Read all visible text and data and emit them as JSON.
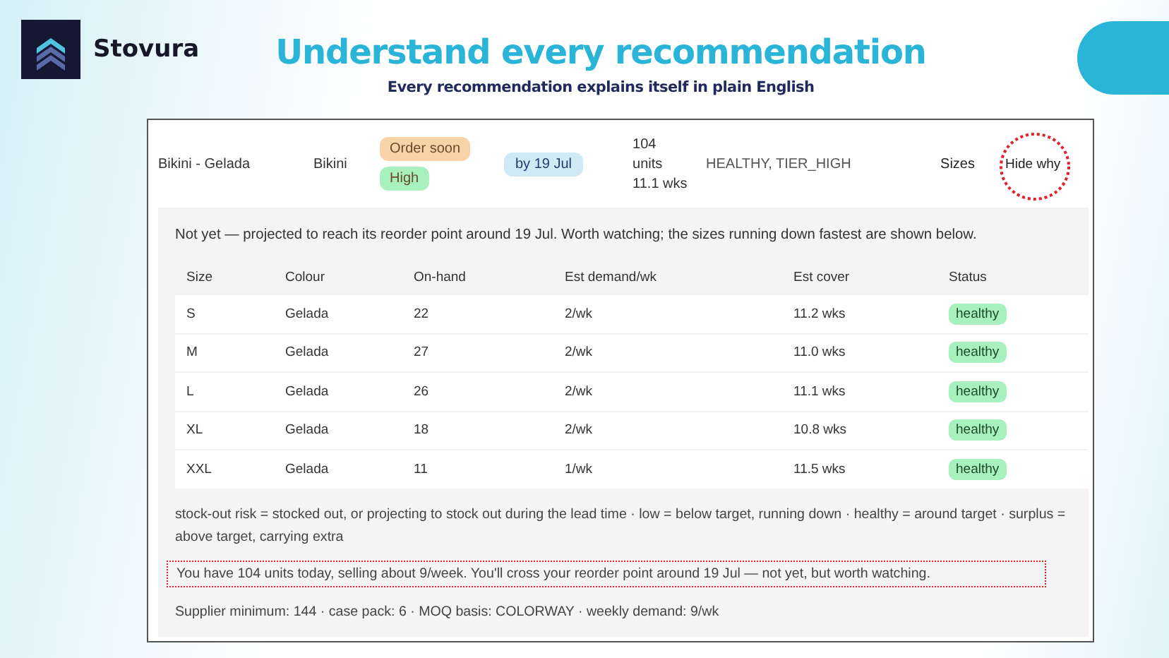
{
  "brand": {
    "name": "Stovura"
  },
  "headline": "Understand every recommendation",
  "subheadline": "Every recommendation explains itself in plain English",
  "item_row": {
    "name": "Bikini - Gelada",
    "category": "Bikini",
    "badges": [
      {
        "label": "Order soon",
        "color": "#f8d3a8"
      },
      {
        "label": "High",
        "color": "#a8f0bd"
      }
    ],
    "date_badge": "by 19 Jul",
    "units": [
      "104",
      "units",
      "11.1 wks"
    ],
    "flags": "HEALTHY, TIER_HIGH",
    "sizes_link": "Sizes",
    "hide_why": "Hide why"
  },
  "explanation": {
    "summary": "Not yet — projected to reach its reorder point around 19 Jul. Worth watching; the sizes running down fastest are shown below.",
    "table": {
      "columns": [
        "Size",
        "Colour",
        "On-hand",
        "Est demand/wk",
        "Est cover",
        "Status"
      ],
      "rows": [
        [
          "S",
          "Gelada",
          "22",
          "2/wk",
          "11.2 wks",
          "healthy"
        ],
        [
          "M",
          "Gelada",
          "27",
          "2/wk",
          "11.0 wks",
          "healthy"
        ],
        [
          "L",
          "Gelada",
          "26",
          "2/wk",
          "11.1 wks",
          "healthy"
        ],
        [
          "XL",
          "Gelada",
          "18",
          "2/wk",
          "10.8 wks",
          "healthy"
        ],
        [
          "XXL",
          "Gelada",
          "11",
          "1/wk",
          "11.5 wks",
          "healthy"
        ]
      ]
    },
    "legend": "stock-out risk = stocked out, or projecting to stock out during the lead time · low = below target, running down · healthy = around target · surplus = above target, carrying extra",
    "plain_english": "You have 104 units today, selling about 9/week. You'll cross your reorder point around 19 Jul — not yet, but worth watching.",
    "supplier": "Supplier minimum: 144 · case pack: 6 · MOQ basis: COLORWAY · weekly demand: 9/wk"
  }
}
